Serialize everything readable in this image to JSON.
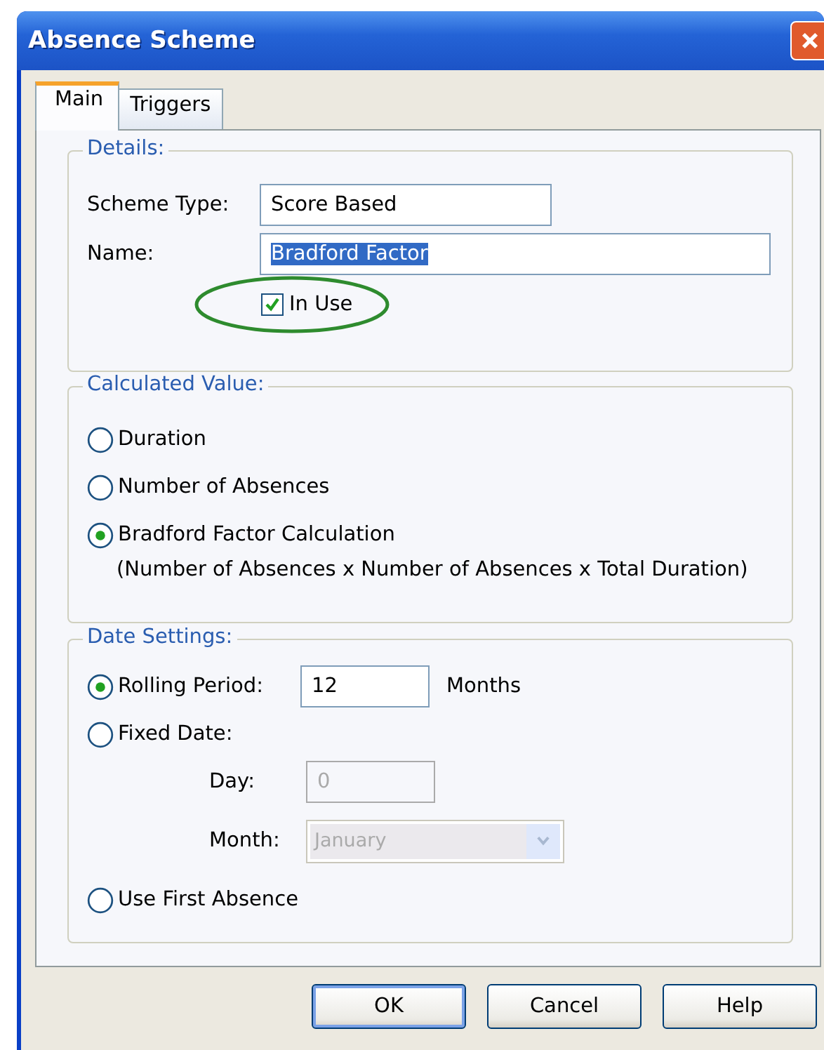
{
  "window": {
    "title": "Absence Scheme"
  },
  "tabs": [
    {
      "label": "Main",
      "selected": true
    },
    {
      "label": "Triggers",
      "selected": false
    }
  ],
  "details": {
    "legend": "Details:",
    "scheme_type": {
      "label": "Scheme Type:",
      "value": "Score Based"
    },
    "name": {
      "label": "Name:",
      "value": "Bradford Factor",
      "highlighted": true
    },
    "in_use": {
      "label": "In Use",
      "checked": true,
      "circled": true
    }
  },
  "calculated_value": {
    "legend": "Calculated Value:",
    "options": [
      {
        "label": "Duration",
        "selected": false
      },
      {
        "label": "Number of Absences",
        "selected": false
      },
      {
        "label": "Bradford Factor Calculation",
        "selected": true
      }
    ],
    "formula": "(Number of Absences x Number of Absences x Total Duration)"
  },
  "date_settings": {
    "legend": "Date Settings:",
    "options": [
      {
        "kind": "rolling",
        "label": "Rolling Period:",
        "selected": true,
        "value": "12",
        "unit": "Months"
      },
      {
        "kind": "fixed",
        "label": "Fixed Date:",
        "selected": false,
        "day_label": "Day:",
        "day_value": "0",
        "month_label": "Month:",
        "month_value": "January",
        "disabled": true
      },
      {
        "kind": "plain",
        "label": "Use First Absence",
        "selected": false
      }
    ]
  },
  "buttons": [
    {
      "label": "OK",
      "default": true
    },
    {
      "label": "Cancel",
      "default": false
    },
    {
      "label": "Help",
      "default": false
    }
  ]
}
